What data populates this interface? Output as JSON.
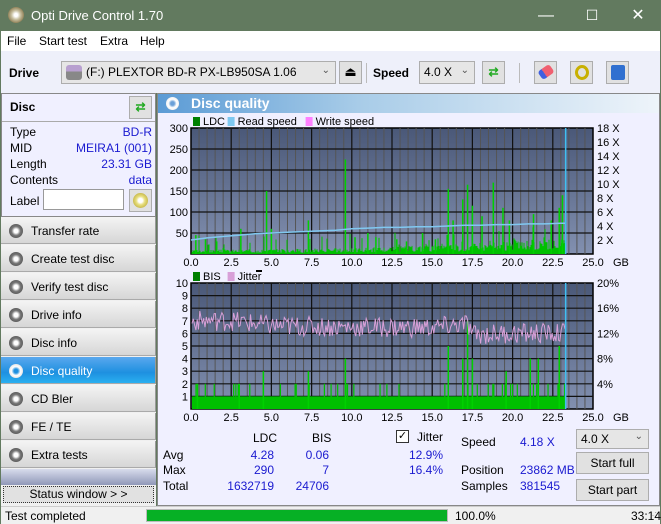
{
  "window": {
    "title": "Opti Drive Control 1.70",
    "minimize": "—",
    "maximize": "☐",
    "close": "✕"
  },
  "menu": [
    "File",
    "Start test",
    "Extra",
    "Help"
  ],
  "toolbar": {
    "drive_label": "Drive",
    "drive_value": "(F:)  PLEXTOR BD-R  PX-LB950SA 1.06",
    "speed_label": "Speed",
    "speed_value": "4.0 X"
  },
  "disc": {
    "header": "Disc",
    "rows": [
      {
        "key": "Type",
        "value": "BD-R"
      },
      {
        "key": "MID",
        "value": "MEIRA1 (001)"
      },
      {
        "key": "Length",
        "value": "23.31 GB"
      },
      {
        "key": "Contents",
        "value": "data"
      }
    ],
    "label_key": "Label",
    "label_value": ""
  },
  "nav": [
    {
      "label": "Transfer rate",
      "active": false
    },
    {
      "label": "Create test disc",
      "active": false
    },
    {
      "label": "Verify test disc",
      "active": false
    },
    {
      "label": "Drive info",
      "active": false
    },
    {
      "label": "Disc info",
      "active": false
    },
    {
      "label": "Disc quality",
      "active": true
    },
    {
      "label": "CD Bler",
      "active": false
    },
    {
      "label": "FE / TE",
      "active": false
    },
    {
      "label": "Extra tests",
      "active": false
    }
  ],
  "status_window_button": "Status window > >",
  "panel_title": "Disc quality",
  "chart_data": [
    {
      "type": "bar",
      "title": "LDC",
      "legend": [
        "LDC",
        "Read speed",
        "Write speed"
      ],
      "legend_colors": [
        "#008000",
        "#7ec8f0",
        "#ff80ff"
      ],
      "xlabel": "GB",
      "x_ticks": [
        "0.0",
        "2.5",
        "5.0",
        "7.5",
        "10.0",
        "12.5",
        "15.0",
        "17.5",
        "20.0",
        "22.5",
        "25.0"
      ],
      "xlim": [
        0,
        25
      ],
      "y_ticks": [
        "50",
        "100",
        "150",
        "200",
        "250",
        "300"
      ],
      "ylim": [
        0,
        300
      ],
      "y2_ticks": [
        "2 X",
        "4 X",
        "6 X",
        "8 X",
        "10 X",
        "12 X",
        "14 X",
        "16 X",
        "18 X"
      ],
      "y2lim": [
        0,
        18
      ],
      "ldc_peaks": [
        [
          0.3,
          45
        ],
        [
          0.9,
          35
        ],
        [
          1.6,
          30
        ],
        [
          3.1,
          60
        ],
        [
          4.7,
          150
        ],
        [
          5.0,
          60
        ],
        [
          7.3,
          80
        ],
        [
          9.6,
          225
        ],
        [
          10.2,
          40
        ],
        [
          11.0,
          50
        ],
        [
          11.5,
          40
        ],
        [
          12.8,
          35
        ],
        [
          13.4,
          30
        ],
        [
          14.4,
          50
        ],
        [
          15.2,
          35
        ],
        [
          16.0,
          155
        ],
        [
          16.3,
          80
        ],
        [
          16.9,
          130
        ],
        [
          17.2,
          165
        ],
        [
          17.5,
          115
        ],
        [
          18.1,
          90
        ],
        [
          18.8,
          170
        ],
        [
          19.4,
          110
        ],
        [
          19.8,
          80
        ],
        [
          21.3,
          95
        ],
        [
          22.4,
          80
        ],
        [
          22.9,
          110
        ],
        [
          23.1,
          140
        ]
      ],
      "ldc_baseline": [
        [
          0,
          8
        ],
        [
          5,
          10
        ],
        [
          10,
          12
        ],
        [
          15,
          18
        ],
        [
          20,
          25
        ],
        [
          23.3,
          30
        ]
      ],
      "read_speed": [
        [
          0,
          2.0
        ],
        [
          1,
          2.3
        ],
        [
          2,
          2.5
        ],
        [
          3,
          2.7
        ],
        [
          4,
          2.9
        ],
        [
          5,
          3.0
        ],
        [
          6,
          3.1
        ],
        [
          7,
          3.2
        ],
        [
          8,
          3.3
        ],
        [
          9,
          3.4
        ],
        [
          10,
          3.6
        ],
        [
          11,
          3.7
        ],
        [
          12,
          3.8
        ],
        [
          13,
          3.8
        ],
        [
          14,
          3.9
        ],
        [
          15,
          3.9
        ],
        [
          16,
          4.0
        ],
        [
          17,
          4.1
        ],
        [
          18,
          4.1
        ],
        [
          19,
          4.2
        ],
        [
          20,
          4.2
        ],
        [
          21,
          4.3
        ],
        [
          22,
          4.3
        ],
        [
          23,
          4.4
        ],
        [
          23.3,
          4.4
        ]
      ],
      "end_marker_gb": 23.3
    },
    {
      "type": "bar",
      "title": "BIS / Jitter",
      "legend": [
        "BIS",
        "Jitter"
      ],
      "legend_colors": [
        "#008000",
        "#d8a0d8"
      ],
      "xlabel": "GB",
      "x_ticks": [
        "0.0",
        "2.5",
        "5.0",
        "7.5",
        "10.0",
        "12.5",
        "15.0",
        "17.5",
        "20.0",
        "22.5",
        "25.0"
      ],
      "xlim": [
        0,
        25
      ],
      "y_ticks": [
        "1",
        "2",
        "3",
        "4",
        "5",
        "6",
        "7",
        "8",
        "9",
        "10"
      ],
      "ylim": [
        0,
        10
      ],
      "y2_ticks": [
        "4%",
        "8%",
        "12%",
        "16%",
        "20%"
      ],
      "y2lim": [
        0,
        20
      ],
      "bis_peaks": [
        [
          0.4,
          2
        ],
        [
          3.0,
          2
        ],
        [
          4.5,
          3
        ],
        [
          7.3,
          3
        ],
        [
          9.6,
          4
        ],
        [
          16.0,
          5
        ],
        [
          16.9,
          4
        ],
        [
          17.2,
          7
        ],
        [
          17.5,
          4
        ],
        [
          19.6,
          3
        ],
        [
          21.1,
          4
        ],
        [
          21.6,
          4
        ],
        [
          22.9,
          5
        ]
      ],
      "jitter_mean_by_gb": [
        [
          0,
          14
        ],
        [
          2.5,
          14
        ],
        [
          5,
          13.2
        ],
        [
          10,
          13
        ],
        [
          15,
          12.9
        ],
        [
          17.2,
          13.5
        ],
        [
          17.5,
          11.8
        ],
        [
          20,
          12
        ],
        [
          23.3,
          12
        ]
      ],
      "end_marker_gb": 23.3
    }
  ],
  "stats": {
    "col_ldc": "LDC",
    "col_bis": "BIS",
    "jitter_label": "Jitter",
    "jitter_checked": true,
    "rows": [
      {
        "label": "Avg",
        "ldc": "4.28",
        "bis": "0.06",
        "jitter": "12.9%"
      },
      {
        "label": "Max",
        "ldc": "290",
        "bis": "7",
        "jitter": "16.4%"
      },
      {
        "label": "Total",
        "ldc": "1632719",
        "bis": "24706",
        "jitter": ""
      }
    ],
    "speed_label": "Speed",
    "speed_value": "4.18 X",
    "position_label": "Position",
    "position_value": "23862 MB",
    "samples_label": "Samples",
    "samples_value": "381545",
    "speed_select": "4.0 X",
    "start_full": "Start full",
    "start_part": "Start part"
  },
  "status": {
    "text": "Test completed",
    "progress_percent": 100.0,
    "progress_label": "100.0%",
    "time": "33:14"
  }
}
